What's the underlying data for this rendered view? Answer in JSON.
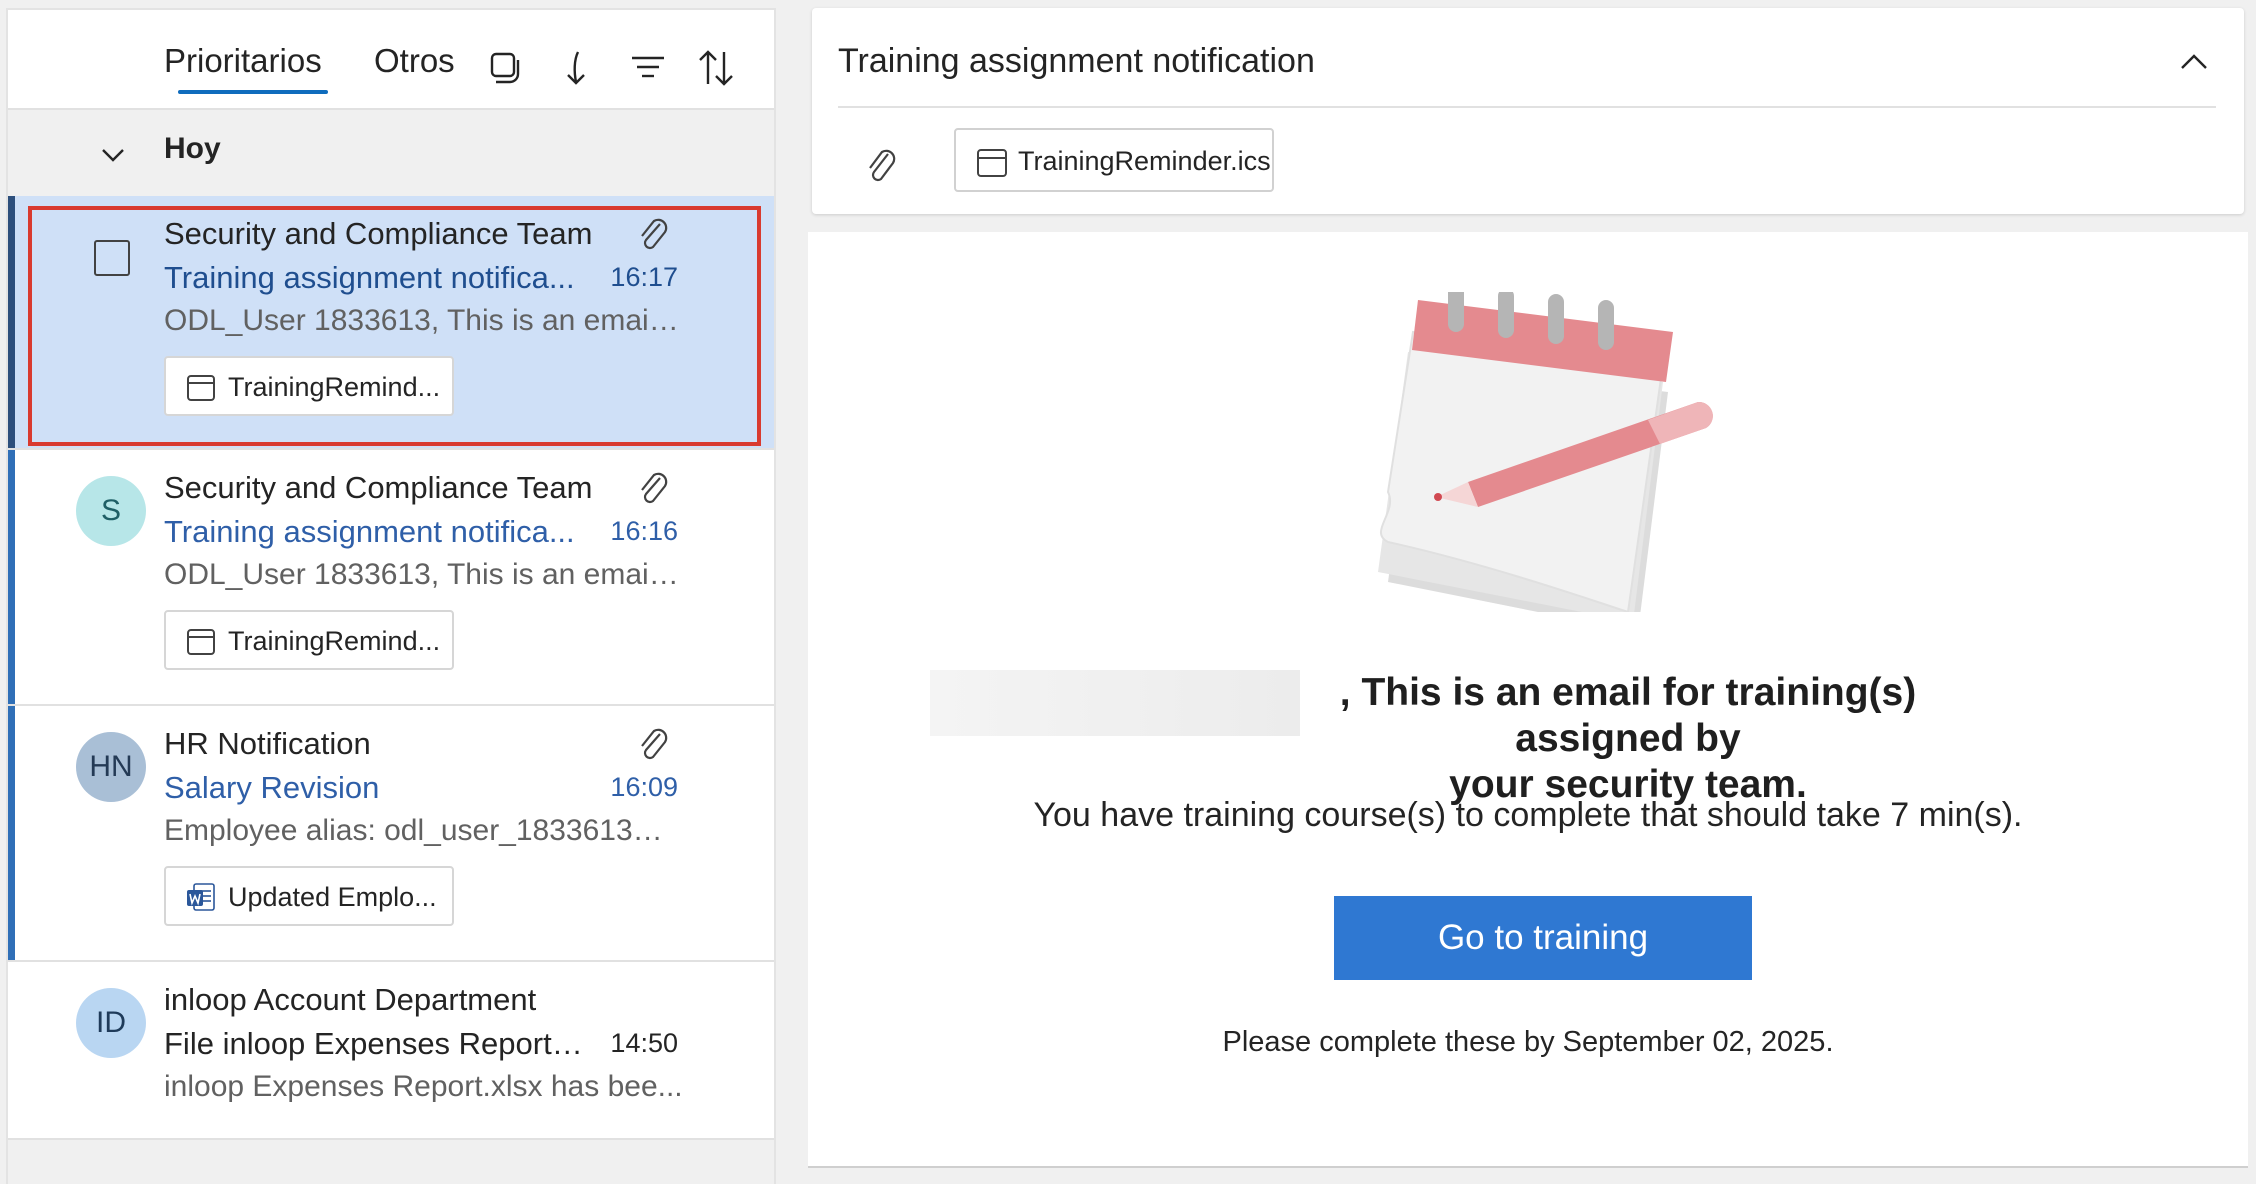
{
  "list": {
    "tabs": {
      "focused": "Prioritarios",
      "other": "Otros"
    },
    "group_label": "Hoy",
    "messages": [
      {
        "sender": "Security and Compliance Team",
        "subject": "Training assignment notifica...",
        "time": "16:17",
        "preview": "ODL_User 1833613, This is an email ...",
        "attachment": "TrainingRemind..."
      },
      {
        "avatar": "S",
        "sender": "Security and Compliance Team",
        "subject": "Training assignment notifica...",
        "time": "16:16",
        "preview": "ODL_User 1833613, This is an email ...",
        "attachment": "TrainingRemind..."
      },
      {
        "avatar": "HN",
        "sender": "HR Notification",
        "subject": "Salary Revision",
        "time": "16:09",
        "preview": "Employee alias: odl_user_1833613@...",
        "attachment": "Updated Emplo..."
      },
      {
        "avatar": "ID",
        "sender": "inloop Account Department",
        "subject": "File inloop Expenses Report.x...",
        "time": "14:50",
        "preview": "inloop Expenses Report.xlsx has bee..."
      }
    ]
  },
  "reading": {
    "title": "Training assignment notification",
    "attachment": "TrainingReminder.ics",
    "headline_line1": ", This is an email for training(s) assigned by",
    "headline_line2": "your security team.",
    "course_text": "You have training course(s) to complete that should take 7 min(s).",
    "button_label": "Go to training",
    "deadline_text": "Please complete these by September 02, 2025."
  },
  "colors": {
    "accent": "#0f6cbd",
    "selected_row": "#cfe0f7",
    "highlight_border": "#d93a2f",
    "button": "#2f78d2",
    "avatar_s": "#b7e6e8",
    "avatar_hn": "#a9bfd6",
    "avatar_id": "#b9d6f2"
  }
}
